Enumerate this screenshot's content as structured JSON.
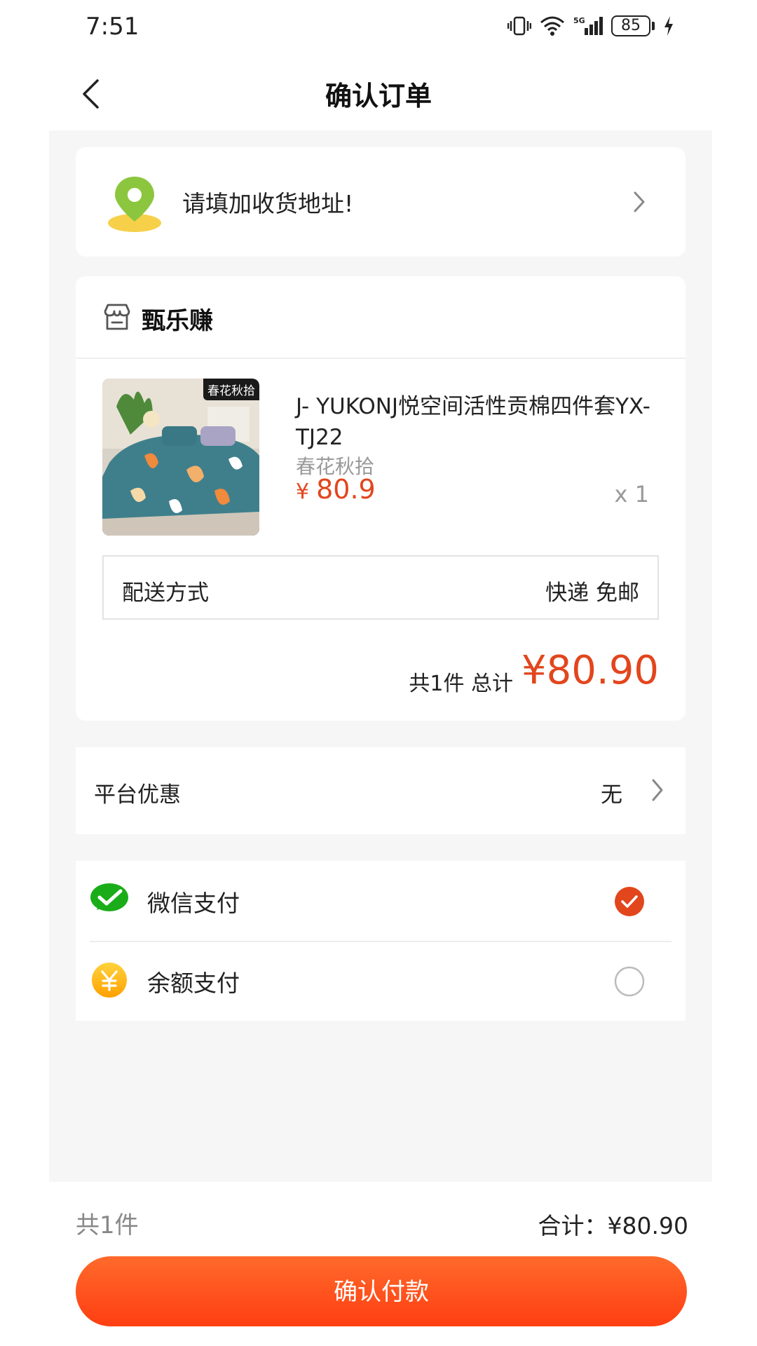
{
  "status_bar": {
    "time": "7:51",
    "battery": "85",
    "network": "5G"
  },
  "header": {
    "title": "确认订单",
    "back_icon": "chevron-left-icon"
  },
  "address": {
    "prompt": "请填加收货地址!",
    "icon": "location-pin-icon"
  },
  "store": {
    "name": "甄乐赚",
    "icon": "store-icon"
  },
  "product": {
    "tag": "春花秋拾",
    "title": "J- YUKONJ悦空间活性贡棉四件套YX-TJ22",
    "variant": "春花秋拾",
    "currency": "¥",
    "price": "80.9",
    "quantity": "x 1"
  },
  "delivery": {
    "label": "配送方式",
    "value": "快递 免邮"
  },
  "summary": {
    "count": "共1件 总计",
    "total": "¥80.90"
  },
  "coupon": {
    "label": "平台优惠",
    "value": "无"
  },
  "payment": {
    "options": [
      {
        "label": "微信支付",
        "icon": "wechat-pay-icon",
        "selected": true
      },
      {
        "label": "余额支付",
        "icon": "balance-yuan-icon",
        "selected": false
      }
    ]
  },
  "bottom": {
    "count": "共1件",
    "total": "合计：¥80.90",
    "confirm_label": "确认付款"
  },
  "colors": {
    "accent": "#e2461d",
    "button_top": "#ff6a2b",
    "button_bottom": "#ff3e12",
    "wechat_green": "#1aad19",
    "balance_yellow": "#ffb300"
  }
}
